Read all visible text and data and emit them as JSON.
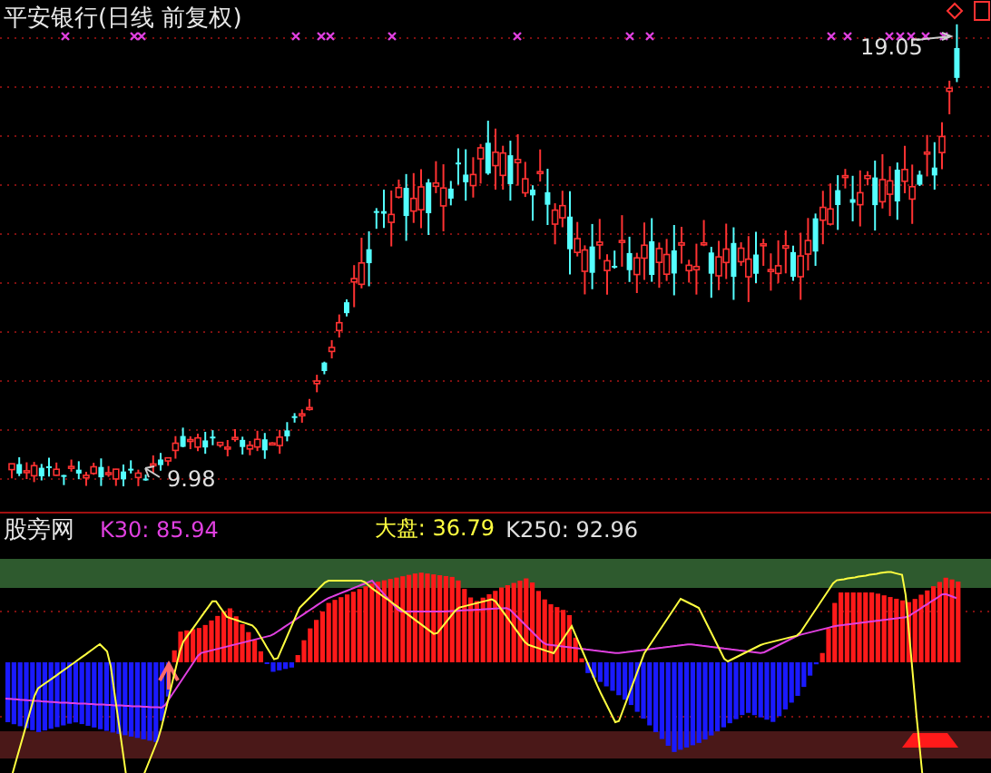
{
  "title": "平安银行(日线 前复权)",
  "price_chart": {
    "high_label": "19.05",
    "low_label": "9.98"
  },
  "indicator": {
    "name": "股旁网",
    "readouts": [
      {
        "kind": "k30",
        "text": "K30: 85.94",
        "color": "#e040e0"
      },
      {
        "kind": "market",
        "text": "大盘: 36.79",
        "color": "#ffff40"
      },
      {
        "kind": "k250",
        "text": "K250: 92.96",
        "color": "#e0e0e0"
      }
    ]
  }
}
